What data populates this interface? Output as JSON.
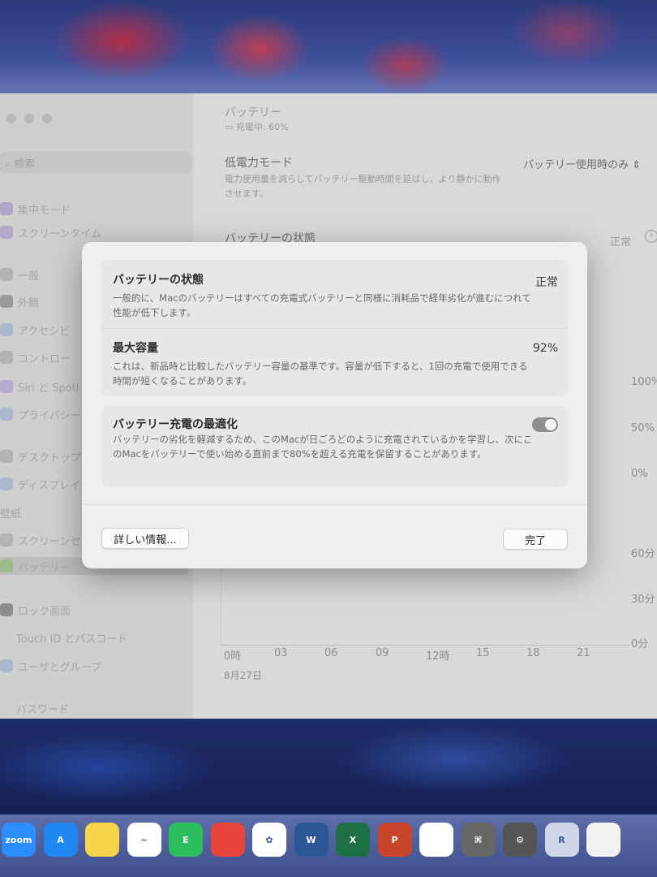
{
  "background_window": {
    "header_title": "バッテリー",
    "header_status": "充電中: 60%",
    "search_placeholder": "検索",
    "low_power": {
      "title": "低電力モード",
      "desc": "電力使用量を減らしてバッテリー駆動時間を延ばし、より静かに動作させます。",
      "value": "バッテリー使用時のみ"
    },
    "battery_health": {
      "title": "バッテリーの状態",
      "value": "正常"
    },
    "sidebar": [
      "集中モード",
      "スクリーンタイム",
      "一般",
      "外観",
      "アクセシビ",
      "コントロー",
      "Siri と Spotl",
      "プライバシー",
      "デスクトップ",
      "ディスプレイ",
      "壁紙",
      "スクリーンセ",
      "バッテリー",
      "ロック画面",
      "Touch ID とパスコード",
      "ユーザとグループ",
      "パスワード"
    ],
    "chart": {
      "y_top": [
        "100%",
        "50%",
        "0%"
      ],
      "y_bottom": [
        "60分",
        "30分",
        "0分"
      ],
      "x": [
        "0時",
        "03",
        "06",
        "09",
        "12時",
        "15",
        "18",
        "21"
      ],
      "date": "8月27日"
    }
  },
  "dialog": {
    "rows": [
      {
        "title": "バッテリーの状態",
        "desc": "一般的に、Macのバッテリーはすべての充電式バッテリーと同様に消耗品で経年劣化が進むにつれて性能が低下します。",
        "value": "正常"
      },
      {
        "title": "最大容量",
        "desc": "これは、新品時と比較したバッテリー容量の基準です。容量が低下すると、1回の充電で使用できる時間が短くなることがあります。",
        "value": "92%"
      },
      {
        "title": "バッテリー充電の最適化",
        "desc": "バッテリーの劣化を軽減するため、このMacが日ごろどのように充電されているかを学習し、次にこのMacをバッテリーで使い始める直前まで80%を超える充電を保留することがあります。",
        "toggle_on": true
      }
    ],
    "more_info_label": "詳しい情報...",
    "done_label": "完了"
  },
  "dock": [
    {
      "name": "zoom",
      "label": "zoom",
      "color": "#2d8cff"
    },
    {
      "name": "app-store",
      "label": "A",
      "color": "#1e88f0"
    },
    {
      "name": "notes",
      "label": "",
      "color": "#f7d54a"
    },
    {
      "name": "freeform",
      "label": "~",
      "color": "#ffffff"
    },
    {
      "name": "evernote",
      "label": "E",
      "color": "#2dbe60"
    },
    {
      "name": "chrome",
      "label": "",
      "color": "#e8453c"
    },
    {
      "name": "photos",
      "label": "✿",
      "color": "#ffffff"
    },
    {
      "name": "word",
      "label": "W",
      "color": "#2b5797"
    },
    {
      "name": "excel",
      "label": "X",
      "color": "#1d7044"
    },
    {
      "name": "powerpoint",
      "label": "P",
      "color": "#c8442b"
    },
    {
      "name": "affinity",
      "label": "",
      "color": "#ffffff"
    },
    {
      "name": "shortcuts",
      "label": "⌘",
      "color": "#666666"
    },
    {
      "name": "system-settings",
      "label": "⚙",
      "color": "#555555"
    },
    {
      "name": "r-app",
      "label": "R",
      "color": "#cfd6e8"
    },
    {
      "name": "document",
      "label": "",
      "color": "#f2f2f2"
    }
  ]
}
